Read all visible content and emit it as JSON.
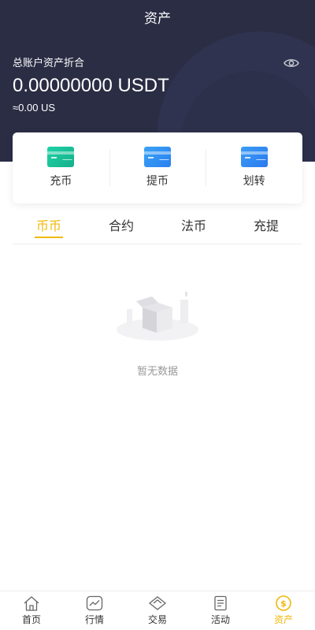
{
  "header": {
    "title": "资产"
  },
  "account": {
    "label": "总账户资产折合",
    "balance": "0.00000000 USDT",
    "approx": "≈0.00 US",
    "visibility_icon": "eye-icon"
  },
  "actions": [
    {
      "label": "充币",
      "icon": "deposit-card-icon",
      "color_from": "#1fd1a5",
      "color_to": "#15b08b"
    },
    {
      "label": "提币",
      "icon": "withdraw-card-icon",
      "color_from": "#3aa4f5",
      "color_to": "#2a7ff0"
    },
    {
      "label": "划转",
      "icon": "transfer-card-icon",
      "color_from": "#3b9df6",
      "color_to": "#2b79ee"
    }
  ],
  "tabs": [
    {
      "label": "币币",
      "active": true
    },
    {
      "label": "合约",
      "active": false
    },
    {
      "label": "法币",
      "active": false
    },
    {
      "label": "充提",
      "active": false
    }
  ],
  "empty": {
    "text": "暂无数据",
    "icon": "empty-box-icon"
  },
  "bottom_nav": [
    {
      "label": "首页",
      "icon": "home-icon",
      "active": false
    },
    {
      "label": "行情",
      "icon": "chart-icon",
      "active": false
    },
    {
      "label": "交易",
      "icon": "exchange-icon",
      "active": false
    },
    {
      "label": "活动",
      "icon": "document-icon",
      "active": false
    },
    {
      "label": "资产",
      "icon": "dollar-coin-icon",
      "active": true
    }
  ],
  "colors": {
    "header_bg": "#2a2d44",
    "accent": "#f0b90b"
  }
}
